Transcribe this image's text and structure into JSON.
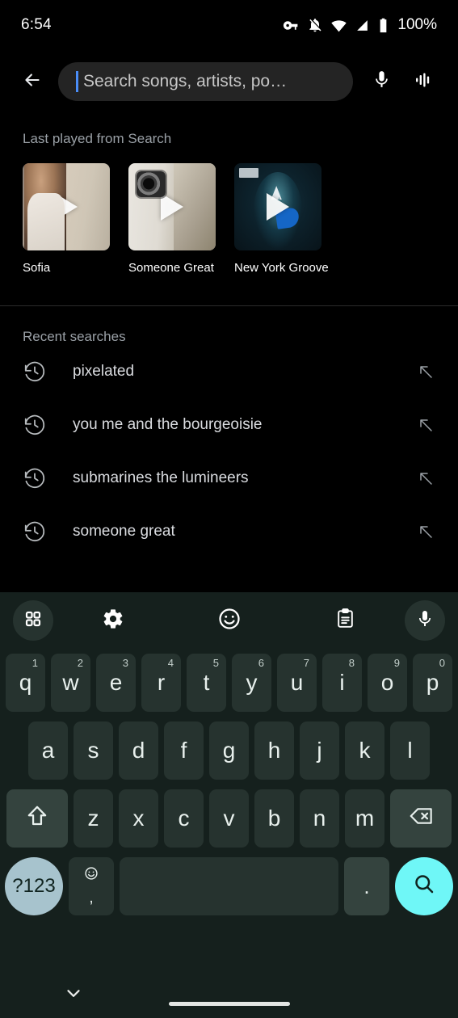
{
  "status_bar": {
    "time": "6:54",
    "battery_percent": "100%",
    "icons": [
      "vpn-key-icon",
      "notifications-off-icon",
      "wifi-icon",
      "cellular-signal-icon",
      "battery-icon"
    ]
  },
  "header": {
    "back_icon": "back-arrow-icon",
    "search_placeholder": "Search songs, artists, po…",
    "search_value": "",
    "mic_icon": "microphone-icon",
    "sound_search_icon": "sound-waveform-icon",
    "caret_color": "#4a8df8"
  },
  "last_played": {
    "title": "Last played from Search",
    "cards": [
      {
        "title": "Sofia",
        "play_icon": "play-icon"
      },
      {
        "title": "Someone Great",
        "play_icon": "play-icon"
      },
      {
        "title": "New York Groove",
        "play_icon": "play-icon"
      }
    ]
  },
  "recent_searches": {
    "title": "Recent searches",
    "items": [
      {
        "label": "pixelated",
        "history_icon": "history-clock-icon",
        "insert_icon": "arrow-up-left-icon"
      },
      {
        "label": "you me and the bourgeoisie",
        "history_icon": "history-clock-icon",
        "insert_icon": "arrow-up-left-icon"
      },
      {
        "label": "submarines the lumineers",
        "history_icon": "history-clock-icon",
        "insert_icon": "arrow-up-left-icon"
      },
      {
        "label": "someone great",
        "history_icon": "history-clock-icon",
        "insert_icon": "arrow-up-left-icon"
      }
    ]
  },
  "keyboard": {
    "toolbar": [
      {
        "name": "apps-grid-icon"
      },
      {
        "name": "settings-gear-icon"
      },
      {
        "name": "emoji-smiley-icon"
      },
      {
        "name": "clipboard-icon"
      },
      {
        "name": "microphone-icon"
      }
    ],
    "row1": [
      {
        "key": "q",
        "sup": "1"
      },
      {
        "key": "w",
        "sup": "2"
      },
      {
        "key": "e",
        "sup": "3"
      },
      {
        "key": "r",
        "sup": "4"
      },
      {
        "key": "t",
        "sup": "5"
      },
      {
        "key": "y",
        "sup": "6"
      },
      {
        "key": "u",
        "sup": "7"
      },
      {
        "key": "i",
        "sup": "8"
      },
      {
        "key": "o",
        "sup": "9"
      },
      {
        "key": "p",
        "sup": "0"
      }
    ],
    "row2": [
      {
        "key": "a"
      },
      {
        "key": "s"
      },
      {
        "key": "d"
      },
      {
        "key": "f"
      },
      {
        "key": "g"
      },
      {
        "key": "h"
      },
      {
        "key": "j"
      },
      {
        "key": "k"
      },
      {
        "key": "l"
      }
    ],
    "row3": [
      {
        "key": "z"
      },
      {
        "key": "x"
      },
      {
        "key": "c"
      },
      {
        "key": "v"
      },
      {
        "key": "b"
      },
      {
        "key": "n"
      },
      {
        "key": "m"
      }
    ],
    "shift_icon": "shift-arrow-icon",
    "backspace_icon": "backspace-delete-icon",
    "symbols_label": "?123",
    "comma_key": {
      "top_icon": "emoji-smiley-icon",
      "label": ","
    },
    "space_label": "",
    "period_label": ".",
    "enter_icon": "search-magnifier-icon",
    "colors": {
      "background": "#15201d",
      "key": "#26332f",
      "modifier_key": "#34433e",
      "symbols_key": "#a7c3cd",
      "enter_key": "#6ff7f7"
    }
  },
  "navigation_bar": {
    "hide_keyboard_icon": "chevron-down-icon",
    "home_indicator": "home-gesture-bar"
  }
}
